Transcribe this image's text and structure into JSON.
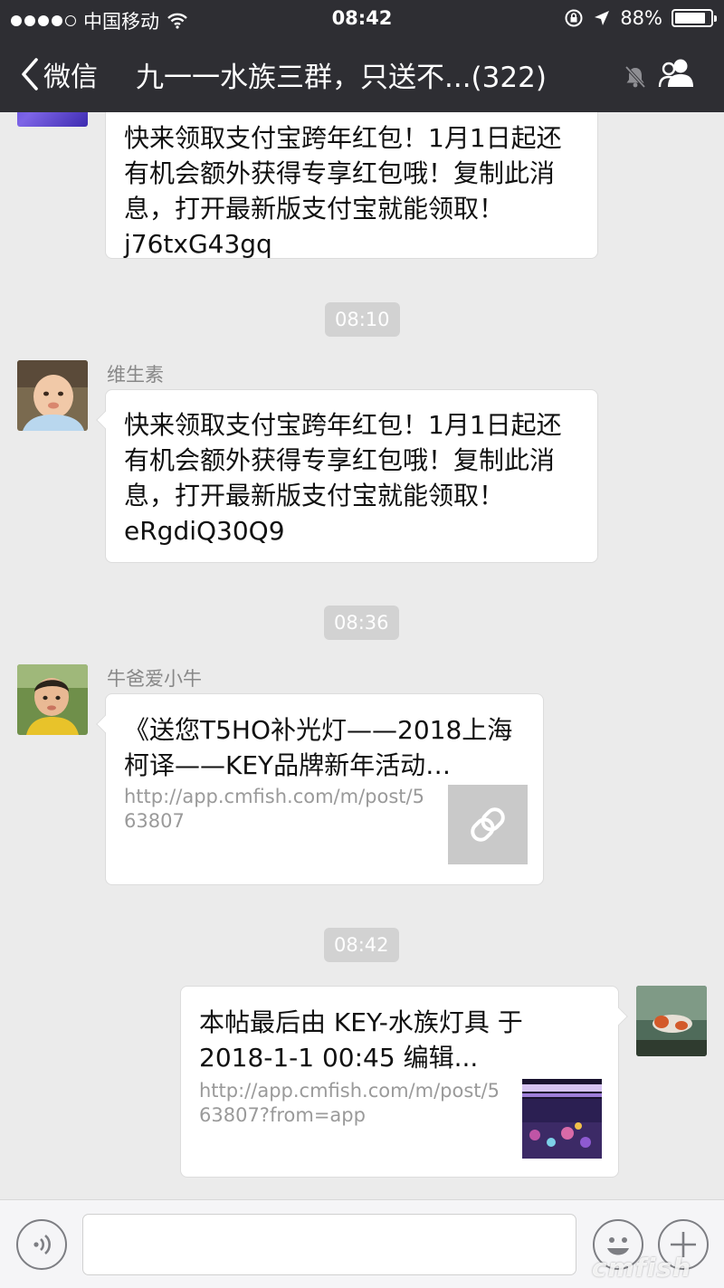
{
  "status_bar": {
    "carrier": "中国移动",
    "time": "08:42",
    "battery_percent": "88%",
    "battery_level": 0.88
  },
  "nav": {
    "back_label": "微信",
    "title": "九一一水族三群，只送不...(322)"
  },
  "messages": [
    {
      "text": "快来领取支付宝跨年红包！1月1日起还有机会额外获得专享红包哦！复制此消息，打开最新版支付宝就能领取！j76txG43gq"
    },
    {
      "time": "08:10",
      "sender": "维生素",
      "text": "快来领取支付宝跨年红包！1月1日起还有机会额外获得专享红包哦！复制此消息，打开最新版支付宝就能领取！eRgdiQ30Q9"
    },
    {
      "time": "08:36",
      "sender": "牛爸爱小牛",
      "link_title": "《送您T5HO补光灯——2018上海柯译——KEY品牌新年活动…",
      "link_url": "http://app.cmfish.com/m/post/563807"
    },
    {
      "time": "08:42",
      "link_title": "本帖最后由 KEY-水族灯具 于 2018-1-1 00:45 编辑...",
      "link_url": "http://app.cmfish.com/m/post/563807?from=app"
    }
  ],
  "watermark": "cmfish",
  "icons": {
    "signal": "signal-dots-icon",
    "wifi": "wifi-icon",
    "lock": "rotation-lock-icon",
    "location": "location-arrow-icon",
    "back": "chevron-left-icon",
    "mute": "mute-bell-icon",
    "group": "group-members-icon",
    "voice": "voice-input-icon",
    "emoji": "emoji-icon",
    "plus": "plus-icon",
    "link": "link-icon"
  },
  "colors": {
    "bar_bg": "#2e2e33",
    "chat_bg": "#ebebeb",
    "bubble_bg": "#ffffff",
    "time_chip": "#d2d2d2"
  }
}
